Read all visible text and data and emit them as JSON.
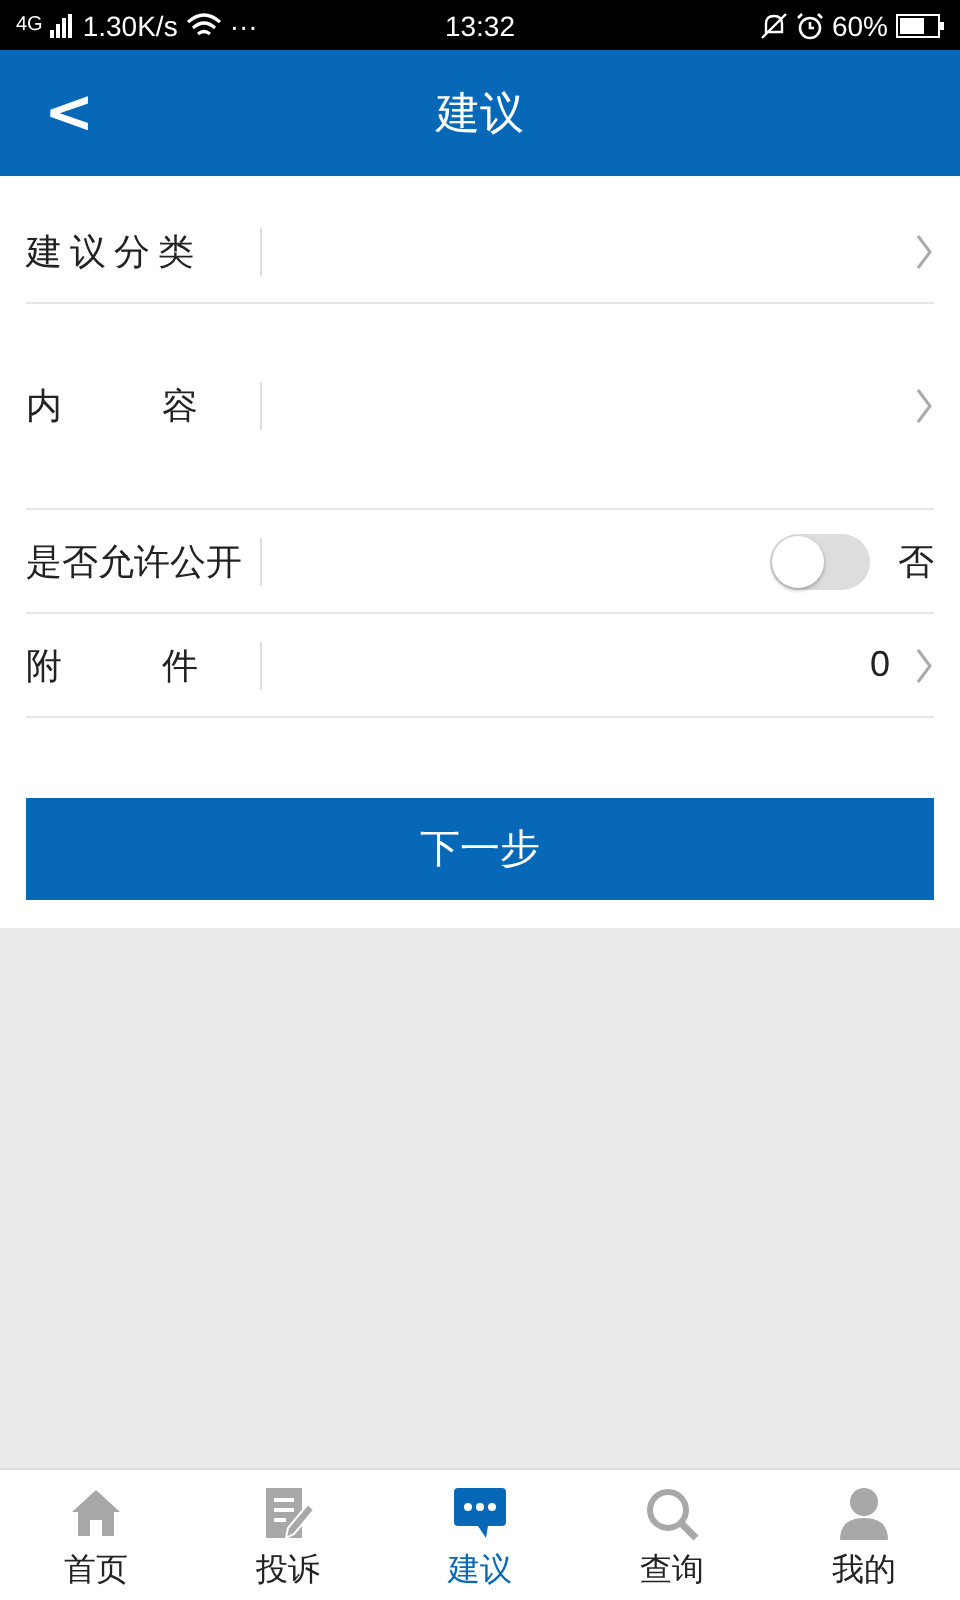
{
  "status_bar": {
    "network": "4G",
    "speed": "1.30K/s",
    "more": "···",
    "time": "13:32",
    "battery": "60%"
  },
  "header": {
    "back": "<",
    "title": "建议"
  },
  "form": [
    {
      "kind": "select",
      "label": "建议分类"
    },
    {
      "kind": "textarea",
      "label": "内 容"
    },
    {
      "kind": "toggle",
      "label": "是否允许公开",
      "on": false,
      "value": "否"
    },
    {
      "kind": "count",
      "label": "附 件",
      "value": "0"
    }
  ],
  "next_button": "下一步",
  "tab_bar": [
    {
      "label": "首页",
      "kind": "home",
      "selected": false
    },
    {
      "label": "投诉",
      "kind": "edit",
      "selected": false
    },
    {
      "label": "建议",
      "kind": "chat",
      "selected": true
    },
    {
      "label": "查询",
      "kind": "search",
      "selected": false
    },
    {
      "label": "我的",
      "kind": "user",
      "selected": false
    }
  ]
}
